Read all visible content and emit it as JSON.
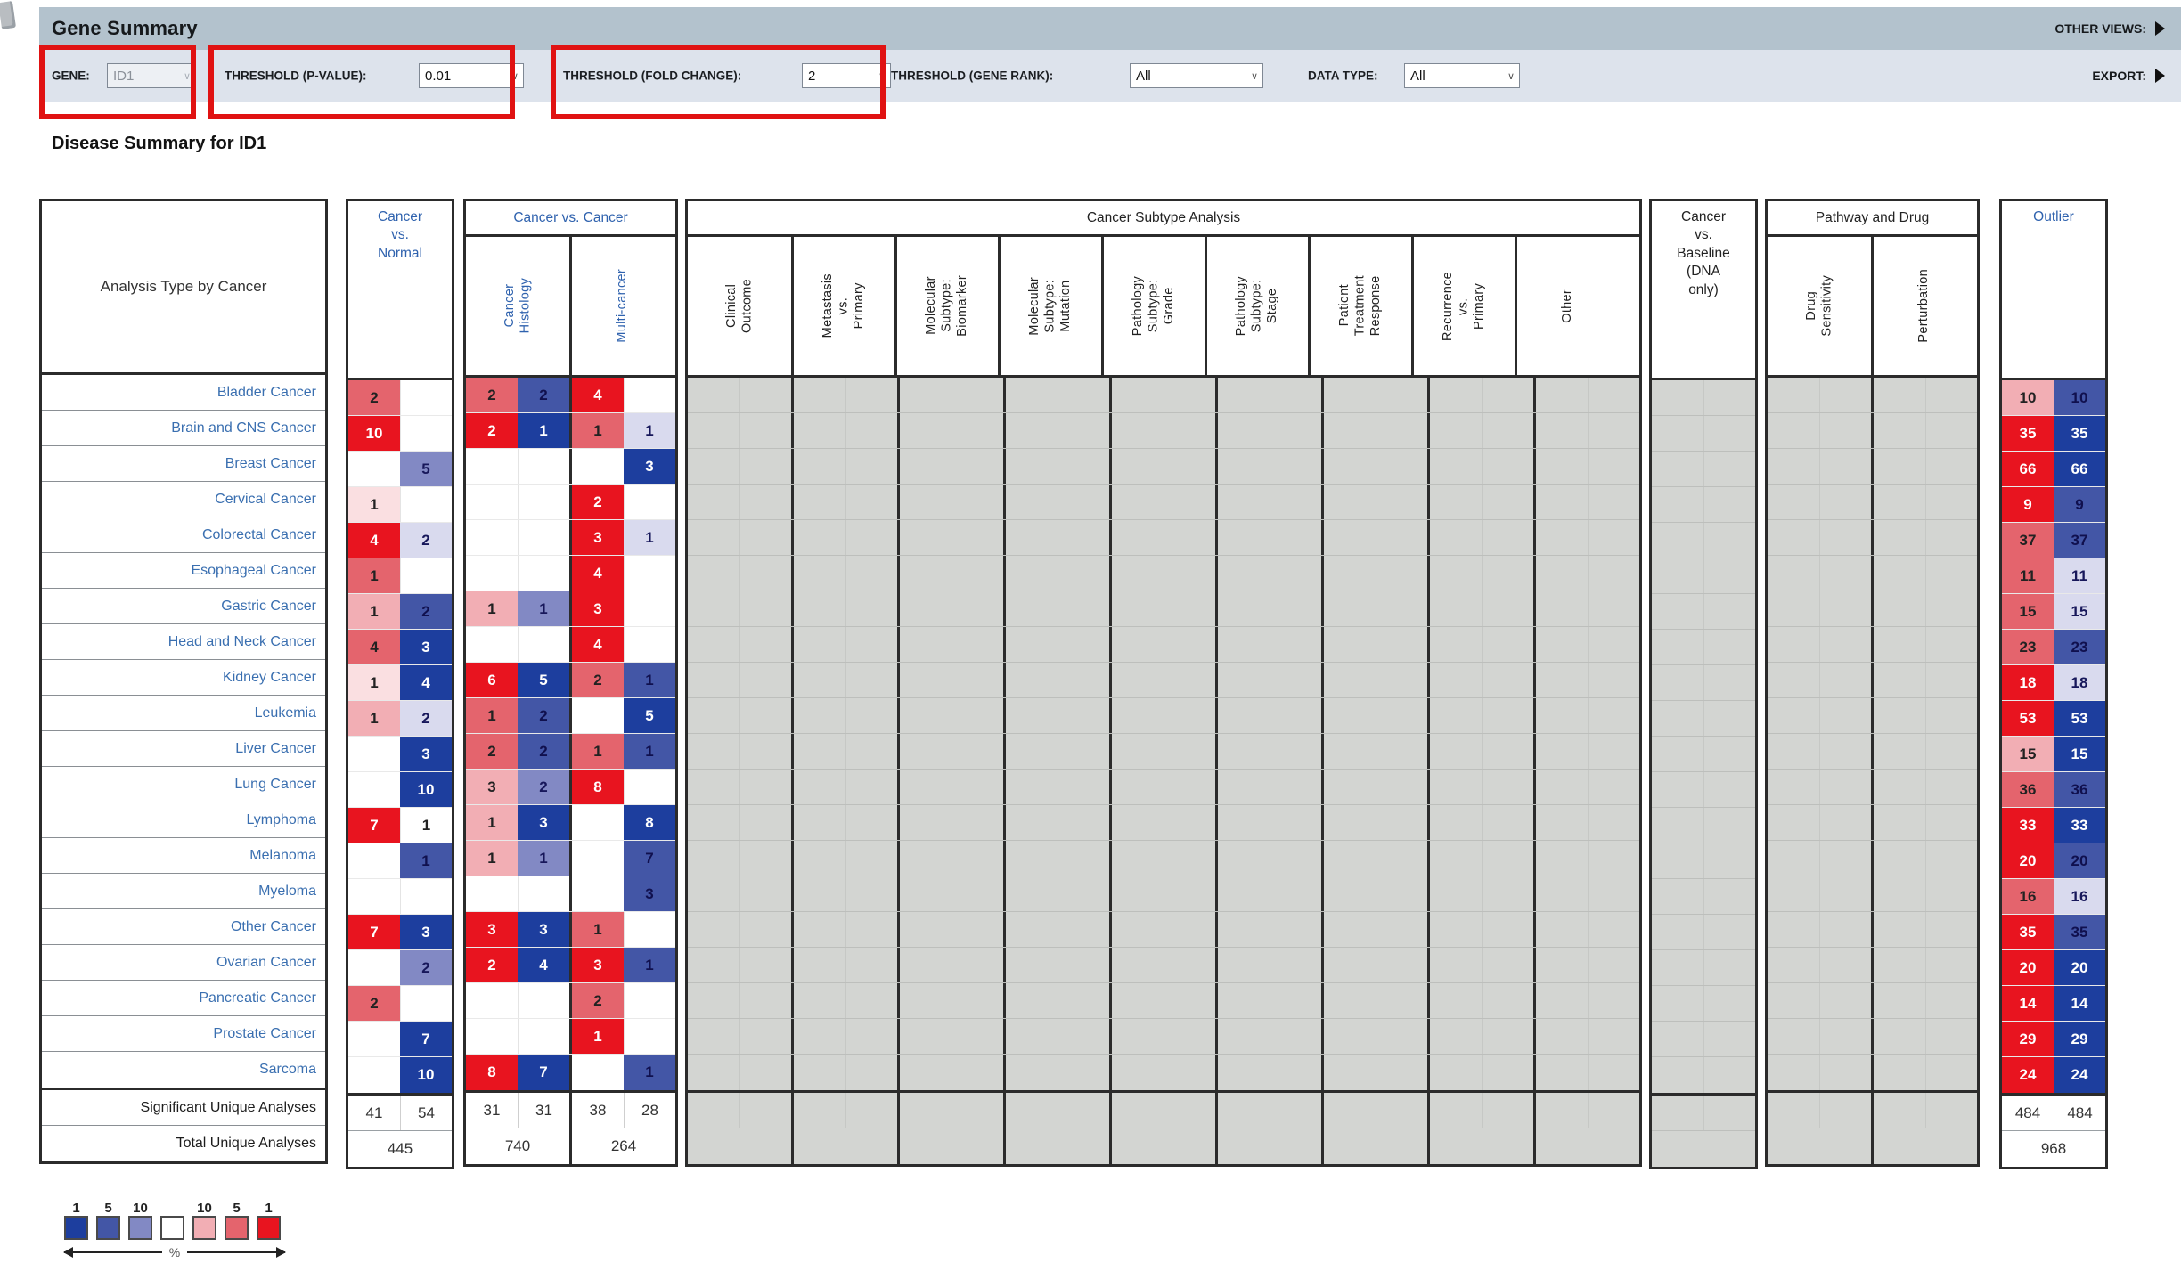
{
  "titlebar": {
    "title": "Gene Summary",
    "other_views_label": "OTHER VIEWS:",
    "export_label": "EXPORT:"
  },
  "filters": {
    "gene_label": "GENE:",
    "gene_value": "ID1",
    "pvalue_label": "THRESHOLD (P-VALUE):",
    "pvalue_value": "0.01",
    "fold_label": "THRESHOLD (FOLD CHANGE):",
    "fold_value": "2",
    "rank_label": "THRESHOLD (GENE RANK):",
    "rank_value": "All",
    "datatype_label": "DATA TYPE:",
    "datatype_value": "All"
  },
  "section_title": "Disease Summary for ID1",
  "palette": {
    "b1": "#1d3e9e",
    "b5": "#4356a6",
    "b10": "#8289c4",
    "b25": "#d9daee",
    "w": "#ffffff",
    "r25": "#fadfe1",
    "r10": "#f2aeb4",
    "r5": "#e4646d",
    "r1": "#e8141f",
    "gray": "#d3d5d2",
    "blue_header": "#2f62ae",
    "link_blue": "#3a6fb0",
    "annotation_red": "#e01212"
  },
  "table": {
    "corner_label": "Analysis Type by Cancer",
    "groups": [
      {
        "id": "cvn",
        "kind": "tall",
        "blue": true,
        "title_lines": [
          "Cancer",
          "vs.",
          "Normal"
        ],
        "pairs": [
          {
            "key": "cvn"
          }
        ]
      },
      {
        "id": "cvc",
        "kind": "titled",
        "blue": true,
        "title": "Cancer vs. Cancer",
        "pairs": [
          {
            "key": "ch",
            "label": "Cancer\nHistology"
          },
          {
            "key": "mc",
            "label": "Multi-cancer"
          }
        ]
      },
      {
        "id": "subtype",
        "kind": "titled",
        "gray": true,
        "title": "Cancer Subtype Analysis",
        "pairs": [
          {
            "label": "Clinical\nOutcome"
          },
          {
            "label": "Metastasis\nvs.\nPrimary"
          },
          {
            "label": "Molecular\nSubtype:\nBiomarker"
          },
          {
            "label": "Molecular\nSubtype:\nMutation"
          },
          {
            "label": "Pathology\nSubtype:\nGrade"
          },
          {
            "label": "Pathology\nSubtype:\nStage"
          },
          {
            "label": "Patient\nTreatment\nResponse"
          },
          {
            "label": "Recurrence\nvs.\nPrimary"
          },
          {
            "label": "Other"
          }
        ]
      },
      {
        "id": "baseline",
        "kind": "tall",
        "gray": true,
        "title_lines": [
          "Cancer",
          "vs.",
          "Baseline",
          "(DNA",
          "only)"
        ],
        "pairs": [
          {}
        ]
      },
      {
        "id": "pathway",
        "kind": "titled",
        "gray": true,
        "title": "Pathway and Drug",
        "pairs": [
          {
            "label": "Drug\nSensitivity"
          },
          {
            "label": "Perturbation"
          }
        ]
      },
      {
        "id": "outlier",
        "kind": "tall",
        "blue": true,
        "detached": true,
        "title_lines": [
          "Outlier"
        ],
        "pairs": [
          {
            "key": "outlier"
          }
        ]
      }
    ],
    "rows": [
      {
        "label": "Bladder Cancer",
        "cvn": [
          [
            "2",
            "r5"
          ],
          null
        ],
        "ch": [
          [
            "2",
            "r5"
          ],
          [
            "2",
            "b5"
          ]
        ],
        "mc": [
          [
            "4",
            "r1"
          ],
          null
        ],
        "outlier": [
          [
            "10",
            "r10"
          ],
          [
            "10",
            "b5"
          ]
        ]
      },
      {
        "label": "Brain and CNS Cancer",
        "cvn": [
          [
            "10",
            "r1"
          ],
          null
        ],
        "ch": [
          [
            "2",
            "r1"
          ],
          [
            "1",
            "b1"
          ]
        ],
        "mc": [
          [
            "1",
            "r5"
          ],
          [
            "1",
            "b25"
          ]
        ],
        "outlier": [
          [
            "35",
            "r1"
          ],
          [
            "35",
            "b1"
          ]
        ]
      },
      {
        "label": "Breast Cancer",
        "cvn": [
          null,
          [
            "5",
            "b10"
          ]
        ],
        "ch": null,
        "mc": [
          null,
          [
            "3",
            "b1"
          ]
        ],
        "outlier": [
          [
            "66",
            "r1"
          ],
          [
            "66",
            "b1"
          ]
        ]
      },
      {
        "label": "Cervical Cancer",
        "cvn": [
          [
            "1",
            "r25"
          ],
          null
        ],
        "ch": null,
        "mc": [
          [
            "2",
            "r1"
          ],
          null
        ],
        "outlier": [
          [
            "9",
            "r1"
          ],
          [
            "9",
            "b5"
          ]
        ]
      },
      {
        "label": "Colorectal Cancer",
        "cvn": [
          [
            "4",
            "r1"
          ],
          [
            "2",
            "b25"
          ]
        ],
        "ch": null,
        "mc": [
          [
            "3",
            "r1"
          ],
          [
            "1",
            "b25"
          ]
        ],
        "outlier": [
          [
            "37",
            "r5"
          ],
          [
            "37",
            "b5"
          ]
        ]
      },
      {
        "label": "Esophageal Cancer",
        "cvn": [
          [
            "1",
            "r5"
          ],
          null
        ],
        "ch": null,
        "mc": [
          [
            "4",
            "r1"
          ],
          null
        ],
        "outlier": [
          [
            "11",
            "r5"
          ],
          [
            "11",
            "b25"
          ]
        ]
      },
      {
        "label": "Gastric Cancer",
        "cvn": [
          [
            "1",
            "r10"
          ],
          [
            "2",
            "b5"
          ]
        ],
        "ch": [
          [
            "1",
            "r10"
          ],
          [
            "1",
            "b10"
          ]
        ],
        "mc": [
          [
            "3",
            "r1"
          ],
          null
        ],
        "outlier": [
          [
            "15",
            "r5"
          ],
          [
            "15",
            "b25"
          ]
        ]
      },
      {
        "label": "Head and Neck Cancer",
        "cvn": [
          [
            "4",
            "r5"
          ],
          [
            "3",
            "b1"
          ]
        ],
        "ch": null,
        "mc": [
          [
            "4",
            "r1"
          ],
          null
        ],
        "outlier": [
          [
            "23",
            "r5"
          ],
          [
            "23",
            "b5"
          ]
        ]
      },
      {
        "label": "Kidney Cancer",
        "cvn": [
          [
            "1",
            "r25"
          ],
          [
            "4",
            "b1"
          ]
        ],
        "ch": [
          [
            "6",
            "r1"
          ],
          [
            "5",
            "b1"
          ]
        ],
        "mc": [
          [
            "2",
            "r5"
          ],
          [
            "1",
            "b5"
          ]
        ],
        "outlier": [
          [
            "18",
            "r1"
          ],
          [
            "18",
            "b25"
          ]
        ]
      },
      {
        "label": "Leukemia",
        "cvn": [
          [
            "1",
            "r10"
          ],
          [
            "2",
            "b25"
          ]
        ],
        "ch": [
          [
            "1",
            "r5"
          ],
          [
            "2",
            "b5"
          ]
        ],
        "mc": [
          null,
          [
            "5",
            "b1"
          ]
        ],
        "outlier": [
          [
            "53",
            "r1"
          ],
          [
            "53",
            "b1"
          ]
        ]
      },
      {
        "label": "Liver Cancer",
        "cvn": [
          null,
          [
            "3",
            "b1"
          ]
        ],
        "ch": [
          [
            "2",
            "r5"
          ],
          [
            "2",
            "b5"
          ]
        ],
        "mc": [
          [
            "1",
            "r5"
          ],
          [
            "1",
            "b5"
          ]
        ],
        "outlier": [
          [
            "15",
            "r10"
          ],
          [
            "15",
            "b1"
          ]
        ]
      },
      {
        "label": "Lung Cancer",
        "cvn": [
          null,
          [
            "10",
            "b1"
          ]
        ],
        "ch": [
          [
            "3",
            "r10"
          ],
          [
            "2",
            "b10"
          ]
        ],
        "mc": [
          [
            "8",
            "r1"
          ],
          null
        ],
        "outlier": [
          [
            "36",
            "r5"
          ],
          [
            "36",
            "b5"
          ]
        ]
      },
      {
        "label": "Lymphoma",
        "cvn": [
          [
            "7",
            "r1"
          ],
          [
            "1",
            "w"
          ]
        ],
        "ch": [
          [
            "1",
            "r10"
          ],
          [
            "3",
            "b1"
          ]
        ],
        "mc": [
          null,
          [
            "8",
            "b1"
          ]
        ],
        "outlier": [
          [
            "33",
            "r1"
          ],
          [
            "33",
            "b1"
          ]
        ]
      },
      {
        "label": "Melanoma",
        "cvn": [
          null,
          [
            "1",
            "b5"
          ]
        ],
        "ch": [
          [
            "1",
            "r10"
          ],
          [
            "1",
            "b10"
          ]
        ],
        "mc": [
          null,
          [
            "7",
            "b5"
          ]
        ],
        "outlier": [
          [
            "20",
            "r1"
          ],
          [
            "20",
            "b5"
          ]
        ]
      },
      {
        "label": "Myeloma",
        "cvn": null,
        "ch": null,
        "mc": [
          null,
          [
            "3",
            "b5"
          ]
        ],
        "outlier": [
          [
            "16",
            "r5"
          ],
          [
            "16",
            "b25"
          ]
        ]
      },
      {
        "label": "Other Cancer",
        "cvn": [
          [
            "7",
            "r1"
          ],
          [
            "3",
            "b1"
          ]
        ],
        "ch": [
          [
            "3",
            "r1"
          ],
          [
            "3",
            "b1"
          ]
        ],
        "mc": [
          [
            "1",
            "r5"
          ],
          null
        ],
        "outlier": [
          [
            "35",
            "r1"
          ],
          [
            "35",
            "b5"
          ]
        ]
      },
      {
        "label": "Ovarian Cancer",
        "cvn": [
          null,
          [
            "2",
            "b10"
          ]
        ],
        "ch": [
          [
            "2",
            "r1"
          ],
          [
            "4",
            "b1"
          ]
        ],
        "mc": [
          [
            "3",
            "r1"
          ],
          [
            "1",
            "b5"
          ]
        ],
        "outlier": [
          [
            "20",
            "r1"
          ],
          [
            "20",
            "b1"
          ]
        ]
      },
      {
        "label": "Pancreatic Cancer",
        "cvn": [
          [
            "2",
            "r5"
          ],
          null
        ],
        "ch": null,
        "mc": [
          [
            "2",
            "r5"
          ],
          null
        ],
        "outlier": [
          [
            "14",
            "r1"
          ],
          [
            "14",
            "b1"
          ]
        ]
      },
      {
        "label": "Prostate Cancer",
        "cvn": [
          null,
          [
            "7",
            "b1"
          ]
        ],
        "ch": null,
        "mc": [
          [
            "1",
            "r1"
          ],
          null
        ],
        "outlier": [
          [
            "29",
            "r1"
          ],
          [
            "29",
            "b1"
          ]
        ]
      },
      {
        "label": "Sarcoma",
        "cvn": [
          null,
          [
            "10",
            "b1"
          ]
        ],
        "ch": [
          [
            "8",
            "r1"
          ],
          [
            "7",
            "b1"
          ]
        ],
        "mc": [
          null,
          [
            "1",
            "b5"
          ]
        ],
        "outlier": [
          [
            "24",
            "r1"
          ],
          [
            "24",
            "b1"
          ]
        ]
      }
    ],
    "summary": {
      "sig_label": "Significant Unique Analyses",
      "total_label": "Total Unique Analyses",
      "sig": {
        "cvn": [
          "41",
          "54"
        ],
        "ch": [
          "31",
          "31"
        ],
        "mc": [
          "38",
          "28"
        ],
        "outlier": [
          "484",
          "484"
        ]
      },
      "total": {
        "cvn": "445",
        "ch": "740",
        "mc": "264",
        "outlier": "968"
      }
    }
  },
  "legend": {
    "left_labels": [
      "1",
      "5",
      "10"
    ],
    "right_labels": [
      "10",
      "5",
      "1"
    ],
    "swatches": [
      "b1",
      "b5",
      "b10",
      "w",
      "r10",
      "r5",
      "r1"
    ],
    "percent_label": "%"
  }
}
